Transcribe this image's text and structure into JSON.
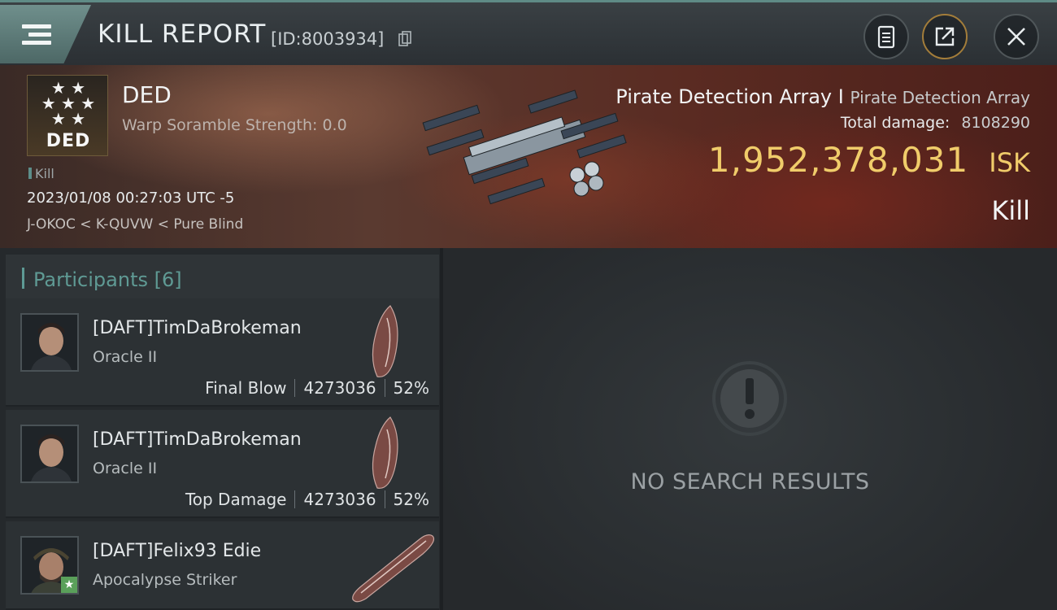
{
  "header": {
    "title": "KILL REPORT",
    "report_id": "[ID:8003934]",
    "icons": [
      "menu-icon",
      "copy-icon",
      "clipboard-icon",
      "share-icon",
      "close-icon"
    ]
  },
  "banner": {
    "logo_text": "DED",
    "logo_stars": "★ ★\n★ ★ ★",
    "faction": "DED",
    "scramble": "Warp Soramble Strength: 0.0",
    "kill_tag": "Kill",
    "timestamp": "2023/01/08 00:27:03 UTC -5",
    "location": "J-OKOC < K-QUVW < Pure Blind",
    "victim_name": "Pirate Detection Array I",
    "victim_type": "Pirate Detection Array",
    "total_damage_label": "Total damage:",
    "total_damage_value": "8108290",
    "isk_value": "1,952,378,031",
    "isk_unit": "ISK",
    "result": "Kill"
  },
  "participants": {
    "label": "Participants",
    "count": "[6]",
    "rows": [
      {
        "name": "[DAFT]TimDaBrokeman",
        "ship": "Oracle II",
        "role": "Final Blow",
        "damage": "4273036",
        "percent": "52%"
      },
      {
        "name": "[DAFT]TimDaBrokeman",
        "ship": "Oracle II",
        "role": "Top Damage",
        "damage": "4273036",
        "percent": "52%"
      },
      {
        "name": "[DAFT]Felix93 Edie",
        "ship": "Apocalypse Striker"
      }
    ]
  },
  "results": {
    "empty_text": "NO SEARCH RESULTS",
    "icon": "alert-icon"
  },
  "colors": {
    "accent_teal": "#5f9a94",
    "isk_gold": "#f0cc6a",
    "share_ring": "#a37d3a"
  }
}
